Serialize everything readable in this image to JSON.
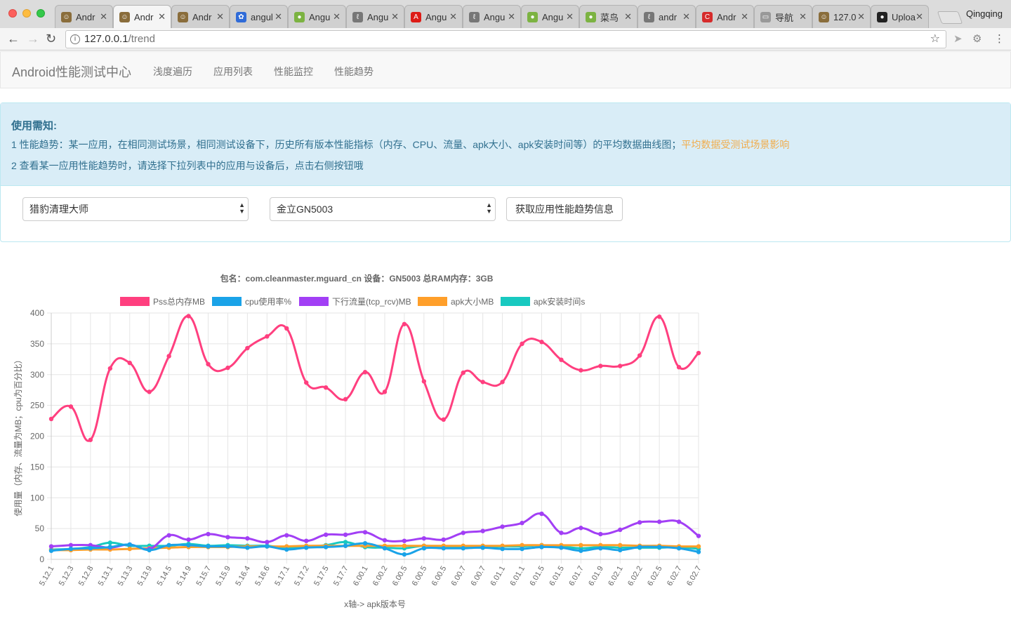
{
  "browser": {
    "tabs": [
      {
        "label": "Andr",
        "icon": "avatar-icon",
        "color": "#8a6d3b"
      },
      {
        "label": "Andr",
        "icon": "avatar-icon",
        "color": "#8a6d3b"
      },
      {
        "label": "Andr",
        "icon": "avatar-icon",
        "color": "#8a6d3b"
      },
      {
        "label": "angul",
        "icon": "paw-icon",
        "color": "#2f6bd8"
      },
      {
        "label": "Angu",
        "icon": "frog-icon",
        "color": "#7cb342"
      },
      {
        "label": "Angu",
        "icon": "wrench-icon",
        "color": "#777777"
      },
      {
        "label": "Angu",
        "icon": "angular-icon",
        "color": "#dd1b16"
      },
      {
        "label": "Angu",
        "icon": "wrench-icon",
        "color": "#777777"
      },
      {
        "label": "Angu",
        "icon": "frog-icon",
        "color": "#7cb342"
      },
      {
        "label": "菜鸟",
        "icon": "frog-icon",
        "color": "#7cb342"
      },
      {
        "label": "andr",
        "icon": "wrench-icon",
        "color": "#777777"
      },
      {
        "label": "Andr",
        "icon": "c-icon",
        "color": "#d62b2b"
      },
      {
        "label": "导航",
        "icon": "document-icon",
        "color": "#999999"
      },
      {
        "label": "127.0",
        "icon": "avatar-icon",
        "color": "#8a6d3b"
      },
      {
        "label": "Uploa",
        "icon": "github-icon",
        "color": "#222222"
      }
    ],
    "active_tab": 1,
    "profile_name": "Qingqing",
    "url_host": "127.0.0.1",
    "url_path": "/trend"
  },
  "navbar": {
    "brand": "Android性能测试中心",
    "links": [
      "浅度遍历",
      "应用列表",
      "性能监控",
      "性能趋势"
    ]
  },
  "notice": {
    "title": "使用需知:",
    "line1": "1 性能趋势：某一应用，在相同测试场景，相同测试设备下，历史所有版本性能指标（内存、CPU、流量、apk大小、apk安装时间等）的平均数据曲线图；",
    "line1_warn": "平均数据受测试场景影响",
    "line2": "2 查看某一应用性能趋势时，请选择下拉列表中的应用与设备后，点击右侧按钮哦"
  },
  "form": {
    "app_select": "猎豹清理大师",
    "device_select": "金立GN5003",
    "submit_label": "获取应用性能趋势信息"
  },
  "chart_data": {
    "type": "line",
    "title": "包名：com.cleanmaster.mguard_cn   设备：GN5003   总RAM内存：3GB",
    "xlabel": "x轴-> apk版本号",
    "ylabel": "使用量（内存、流量为MB；cpu为百分比）",
    "ylim": [
      0,
      400
    ],
    "yticks": [
      0,
      50,
      100,
      150,
      200,
      250,
      300,
      350,
      400
    ],
    "grid": true,
    "legend": "top",
    "categories": [
      "5.12.1",
      "5.12.3",
      "5.12.8",
      "5.13.1",
      "5.13.3",
      "5.13.9",
      "5.14.5",
      "5.14.9",
      "5.15.7",
      "5.15.9",
      "5.16.4",
      "5.16.6",
      "5.17.1",
      "5.17.2",
      "5.17.5",
      "5.17.7",
      "6.00.1",
      "6.00.2",
      "6.00.5",
      "6.00.5",
      "6.00.5",
      "6.00.7",
      "6.00.7",
      "6.01.1",
      "6.01.1",
      "6.01.5",
      "6.01.5",
      "6.01.7",
      "6.01.9",
      "6.02.1",
      "6.02.2",
      "6.02.5",
      "6.02.7",
      "6.02.7"
    ],
    "series": [
      {
        "name": "Pss总内存MB",
        "color": "#ff3f7f",
        "values": [
          228,
          248,
          194,
          310,
          319,
          272,
          330,
          395,
          317,
          311,
          343,
          362,
          375,
          287,
          279,
          260,
          304,
          272,
          382,
          289,
          227,
          303,
          288,
          288,
          350,
          353,
          324,
          307,
          314,
          314,
          331,
          394,
          312,
          335
        ]
      },
      {
        "name": "cpu使用率%",
        "color": "#1aa3e8",
        "values": [
          14,
          17,
          18,
          20,
          24,
          15,
          23,
          23,
          21,
          21,
          19,
          21,
          16,
          19,
          20,
          22,
          26,
          18,
          8,
          18,
          18,
          18,
          19,
          17,
          17,
          20,
          19,
          14,
          18,
          15,
          20,
          20,
          18,
          12
        ]
      },
      {
        "name": "下行流量(tcp_rcv)MB",
        "color": "#a23ff5",
        "values": [
          21,
          23,
          23,
          19,
          24,
          17,
          39,
          32,
          41,
          36,
          34,
          28,
          39,
          30,
          40,
          40,
          44,
          31,
          30,
          34,
          32,
          43,
          46,
          53,
          59,
          74,
          43,
          51,
          41,
          48,
          60,
          61,
          61,
          38
        ]
      },
      {
        "name": "apk大小MB",
        "color": "#ff9f2a",
        "values": [
          15,
          15,
          16,
          16,
          17,
          18,
          19,
          20,
          20,
          20,
          21,
          21,
          21,
          22,
          22,
          22,
          22,
          22,
          22,
          22,
          22,
          22,
          22,
          22,
          23,
          23,
          23,
          23,
          23,
          23,
          22,
          22,
          21,
          21
        ]
      },
      {
        "name": "apk安装时间s",
        "color": "#18c9c0",
        "values": [
          16,
          17,
          20,
          27,
          22,
          22,
          22,
          25,
          22,
          23,
          22,
          22,
          19,
          21,
          23,
          28,
          20,
          19,
          18,
          22,
          20,
          20,
          19,
          21,
          21,
          23,
          21,
          18,
          20,
          19,
          19,
          19,
          20,
          17
        ]
      }
    ]
  }
}
